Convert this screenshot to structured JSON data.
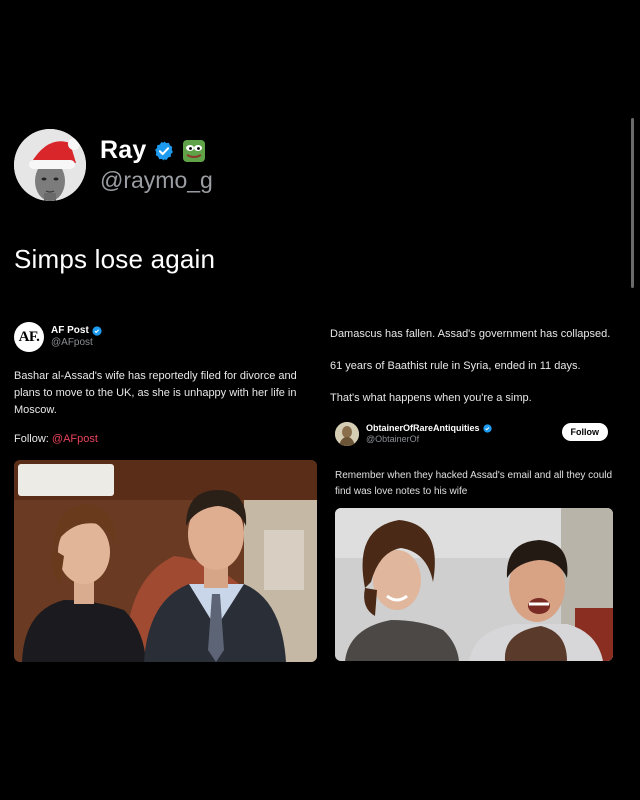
{
  "post": {
    "author": {
      "name": "Ray",
      "handle": "@raymo_g",
      "verified_icon": "verified-badge-icon",
      "emoji_icon": "pepe-frog-icon",
      "avatar_icon": "santa-hat-avatar"
    },
    "text": "Simps lose again"
  },
  "left_card": {
    "account": {
      "logo_text": "AF.",
      "name": "AF Post",
      "handle": "@AFpost"
    },
    "body": "Bashar al-Assad's wife has reportedly filed for divorce and plans to move to the UK, as she is unhappy with her life in Moscow.",
    "follow_prefix": "Follow: ",
    "follow_link": "@AFpost"
  },
  "right_column": {
    "lines": [
      "Damascus has fallen. Assad's government has collapsed.",
      "61 years of Baathist rule in Syria, ended in 11 days.",
      "That's what happens when you're a simp."
    ]
  },
  "right_card": {
    "account": {
      "name": "ObtainerOfRareAntiquities",
      "handle": "@ObtainerOf"
    },
    "follow_button": "Follow",
    "body": "Remember when they hacked Assad's email and all they could find was love notes to his wife"
  },
  "colors": {
    "background": "#000000",
    "verified": "#1d9bf0",
    "link": "#e8435a"
  }
}
